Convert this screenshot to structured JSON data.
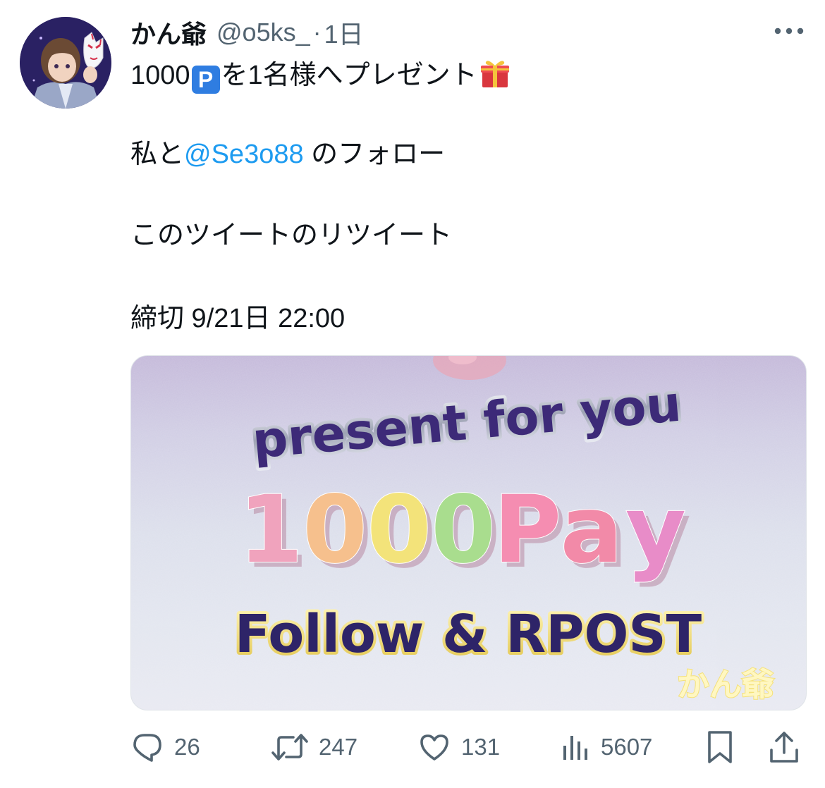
{
  "tweet": {
    "author": {
      "display_name": "かん爺",
      "handle": "@o5ks_",
      "separator": "·",
      "time": "1日"
    },
    "lines": {
      "l1_prefix": "1000",
      "l1_p_icon": "P",
      "l1_suffix": "を1名様へプレゼント",
      "l2_prefix": "私と",
      "l2_mention": "@Se3o88",
      "l2_suffix": " のフォロー",
      "l3": "このツイートのリツイート",
      "l4": "締切 9/21日 22:00"
    },
    "media": {
      "headline": "present for you",
      "amount_chars": [
        "1",
        "0",
        "0",
        "0",
        "P",
        "a",
        "y"
      ],
      "amount_colors": [
        "#f0a3bd",
        "#f6c08d",
        "#f3e37a",
        "#a9dd8e",
        "#f58db1",
        "#f28aa8",
        "#e88cc8"
      ],
      "cta": "Follow & RPOST",
      "watermark": "かん爺"
    },
    "actions": {
      "replies": "26",
      "reposts": "247",
      "likes": "131",
      "views": "5607"
    }
  },
  "icons": {
    "more": "more-horizontal-icon",
    "reply": "reply-bubble-icon",
    "repost": "repost-arrows-icon",
    "like": "heart-icon",
    "views": "views-bar-chart-icon",
    "bookmark": "bookmark-icon",
    "share": "share-upload-icon",
    "gift": "gift-icon",
    "p": "parking-p-icon"
  },
  "colors": {
    "text": "#0f1419",
    "secondary": "#536471",
    "link": "#1d9bf0",
    "p_icon_bg": "#2f7de1"
  }
}
